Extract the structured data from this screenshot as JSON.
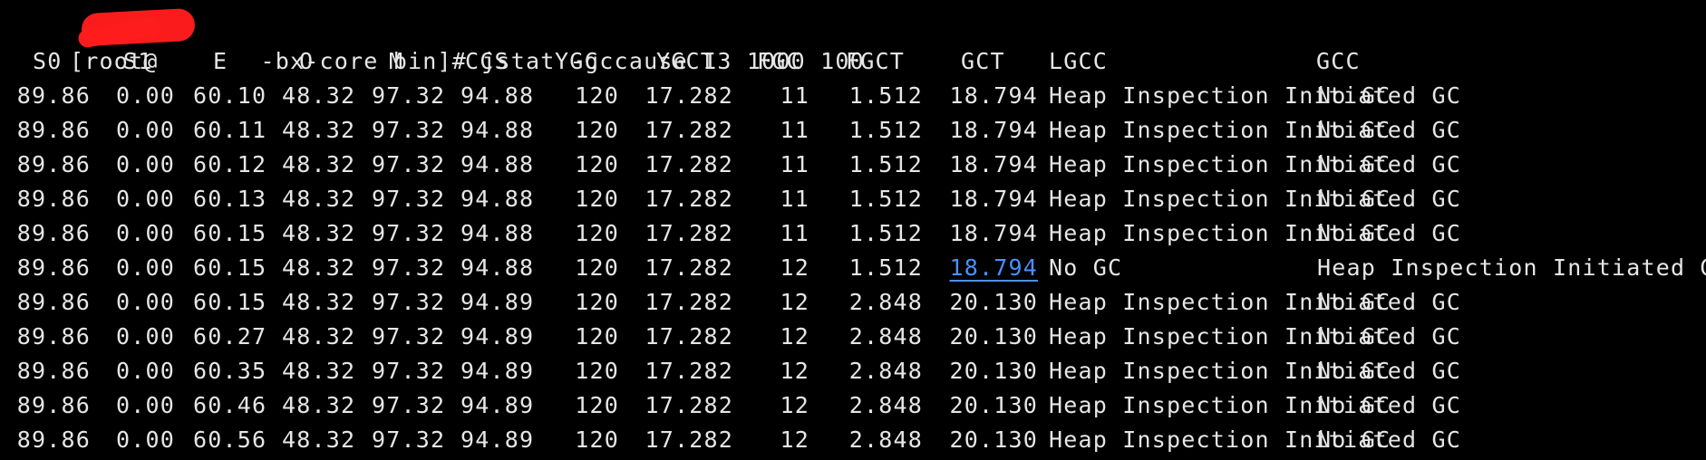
{
  "terminal": {
    "top_fragment": ". . . . . . . . . . . . . . . . . . . . . . . . . . . . . . . . . . . . .",
    "prompt_before_redaction": "[root@",
    "prompt_after_redaction": "-bx-core bin]# jstat -gccause 13 1000 100",
    "headers": [
      "S0",
      "S1",
      "E",
      "O",
      "M",
      "CCS",
      "YGC",
      "YGCT",
      "FGC",
      "FGCT",
      "GCT",
      "LGCC",
      "GCC"
    ],
    "rows": [
      {
        "s0": "89.86",
        "s1": "0.00",
        "e": "60.10",
        "o": "48.32",
        "m": "97.32",
        "ccs": "94.88",
        "ygc": "120",
        "ygct": "17.282",
        "fgc": "11",
        "fgct": "1.512",
        "gct": "18.794",
        "lgcc": "Heap Inspection Initiated GC",
        "gcc": "No GC"
      },
      {
        "s0": "89.86",
        "s1": "0.00",
        "e": "60.11",
        "o": "48.32",
        "m": "97.32",
        "ccs": "94.88",
        "ygc": "120",
        "ygct": "17.282",
        "fgc": "11",
        "fgct": "1.512",
        "gct": "18.794",
        "lgcc": "Heap Inspection Initiated GC",
        "gcc": "No GC"
      },
      {
        "s0": "89.86",
        "s1": "0.00",
        "e": "60.12",
        "o": "48.32",
        "m": "97.32",
        "ccs": "94.88",
        "ygc": "120",
        "ygct": "17.282",
        "fgc": "11",
        "fgct": "1.512",
        "gct": "18.794",
        "lgcc": "Heap Inspection Initiated GC",
        "gcc": "No GC"
      },
      {
        "s0": "89.86",
        "s1": "0.00",
        "e": "60.13",
        "o": "48.32",
        "m": "97.32",
        "ccs": "94.88",
        "ygc": "120",
        "ygct": "17.282",
        "fgc": "11",
        "fgct": "1.512",
        "gct": "18.794",
        "lgcc": "Heap Inspection Initiated GC",
        "gcc": "No GC"
      },
      {
        "s0": "89.86",
        "s1": "0.00",
        "e": "60.15",
        "o": "48.32",
        "m": "97.32",
        "ccs": "94.88",
        "ygc": "120",
        "ygct": "17.282",
        "fgc": "11",
        "fgct": "1.512",
        "gct": "18.794",
        "lgcc": "Heap Inspection Initiated GC",
        "gcc": "No GC"
      },
      {
        "s0": "89.86",
        "s1": "0.00",
        "e": "60.15",
        "o": "48.32",
        "m": "97.32",
        "ccs": "94.88",
        "ygc": "120",
        "ygct": "17.282",
        "fgc": "12",
        "fgct": "1.512",
        "gct": "18.794",
        "lgcc": "No GC",
        "gcc": "Heap Inspection Initiated GC"
      },
      {
        "s0": "89.86",
        "s1": "0.00",
        "e": "60.15",
        "o": "48.32",
        "m": "97.32",
        "ccs": "94.89",
        "ygc": "120",
        "ygct": "17.282",
        "fgc": "12",
        "fgct": "2.848",
        "gct": "20.130",
        "lgcc": "Heap Inspection Initiated GC",
        "gcc": "No GC"
      },
      {
        "s0": "89.86",
        "s1": "0.00",
        "e": "60.27",
        "o": "48.32",
        "m": "97.32",
        "ccs": "94.89",
        "ygc": "120",
        "ygct": "17.282",
        "fgc": "12",
        "fgct": "2.848",
        "gct": "20.130",
        "lgcc": "Heap Inspection Initiated GC",
        "gcc": "No GC"
      },
      {
        "s0": "89.86",
        "s1": "0.00",
        "e": "60.35",
        "o": "48.32",
        "m": "97.32",
        "ccs": "94.89",
        "ygc": "120",
        "ygct": "17.282",
        "fgc": "12",
        "fgct": "2.848",
        "gct": "20.130",
        "lgcc": "Heap Inspection Initiated GC",
        "gcc": "No GC"
      },
      {
        "s0": "89.86",
        "s1": "0.00",
        "e": "60.46",
        "o": "48.32",
        "m": "97.32",
        "ccs": "94.89",
        "ygc": "120",
        "ygct": "17.282",
        "fgc": "12",
        "fgct": "2.848",
        "gct": "20.130",
        "lgcc": "Heap Inspection Initiated GC",
        "gcc": "No GC"
      },
      {
        "s0": "89.86",
        "s1": "0.00",
        "e": "60.56",
        "o": "48.32",
        "m": "97.32",
        "ccs": "94.89",
        "ygc": "120",
        "ygct": "17.282",
        "fgc": "12",
        "fgct": "2.848",
        "gct": "20.130",
        "lgcc": "Heap Inspection Initiated GC",
        "gcc": "No GC"
      }
    ],
    "colors": {
      "background": "#000000",
      "text": "#e6e6e6",
      "redaction": "#ff1d1d",
      "selected": "#4a90ff"
    }
  }
}
